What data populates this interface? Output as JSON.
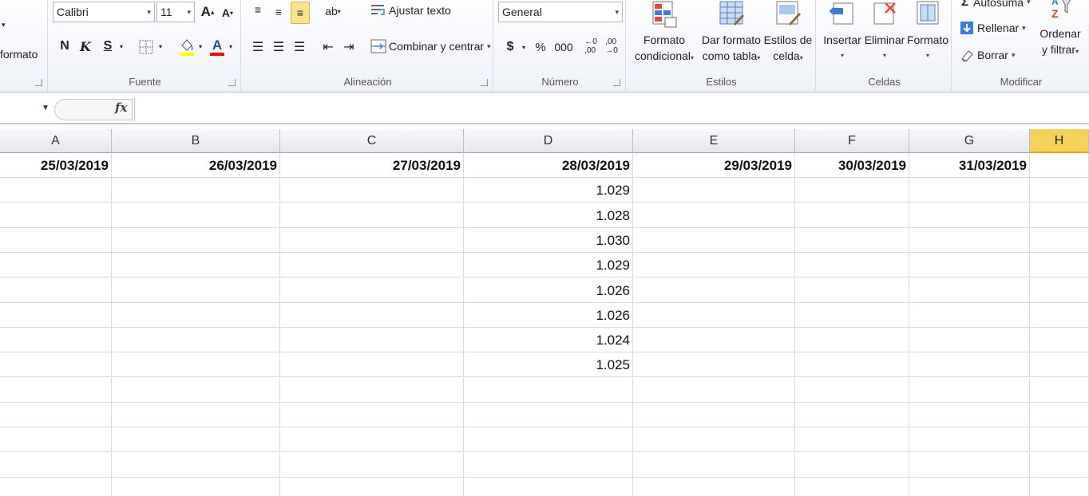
{
  "ribbon": {
    "left_cut_label": "formato",
    "font": {
      "family": "Calibri",
      "size": "11",
      "bold": "N",
      "italic": "K",
      "underline": "S",
      "group_label": "Fuente",
      "fill_color": "#ffff00",
      "font_color": "#ff0000"
    },
    "alignment": {
      "wrap_text": "Ajustar texto",
      "merge_center": "Combinar y centrar",
      "group_label": "Alineación"
    },
    "number": {
      "format": "General",
      "currency": "$",
      "percent": "%",
      "thousands": "000",
      "group_label": "Número"
    },
    "styles": {
      "conditional": [
        "Formato",
        "condicional"
      ],
      "as_table": [
        "Dar formato",
        "como tabla"
      ],
      "cell_styles": [
        "Estilos de",
        "celda"
      ],
      "group_label": "Estilos"
    },
    "cells": {
      "insert": "Insertar",
      "delete": "Eliminar",
      "format": "Formato",
      "group_label": "Celdas"
    },
    "editing": {
      "autosum": "Autosuma",
      "fill": "Rellenar",
      "clear": "Borrar",
      "sort": [
        "Ordenar",
        "y filtrar"
      ],
      "group_label": "Modificar"
    }
  },
  "formula_bar": {
    "fx": "fx"
  },
  "grid": {
    "columns": [
      "A",
      "B",
      "C",
      "D",
      "E",
      "F",
      "G",
      "H"
    ],
    "active_column": "H",
    "header_row": [
      "25/03/2019",
      "26/03/2019",
      "27/03/2019",
      "28/03/2019",
      "29/03/2019",
      "30/03/2019",
      "31/03/2019",
      ""
    ],
    "column_d_values": [
      "1.029",
      "1.028",
      "1.030",
      "1.029",
      "1.026",
      "1.026",
      "1.024",
      "1.025"
    ]
  }
}
